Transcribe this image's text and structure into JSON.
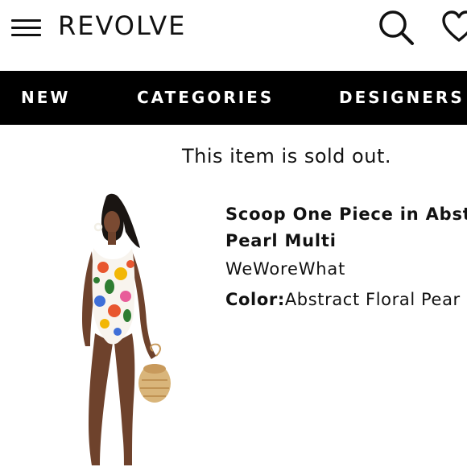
{
  "header": {
    "logo": "REVOLVE",
    "menu_icon": "hamburger-menu-icon",
    "search_icon": "search-icon",
    "wishlist_icon": "heart-icon"
  },
  "nav": {
    "items": [
      {
        "label": "NEW"
      },
      {
        "label": "CATEGORIES"
      },
      {
        "label": "DESIGNERS"
      }
    ]
  },
  "status": {
    "message": "This item is sold out."
  },
  "product": {
    "name_line1": "Scoop One Piece in Abstr",
    "name_line2": "Pearl Multi",
    "brand": "WeWoreWhat",
    "color_label": "Color:",
    "color_value": "Abstract Floral Pear"
  },
  "colors": {
    "nav_background": "#000000",
    "nav_text": "#ffffff",
    "text": "#111111",
    "background": "#ffffff"
  }
}
